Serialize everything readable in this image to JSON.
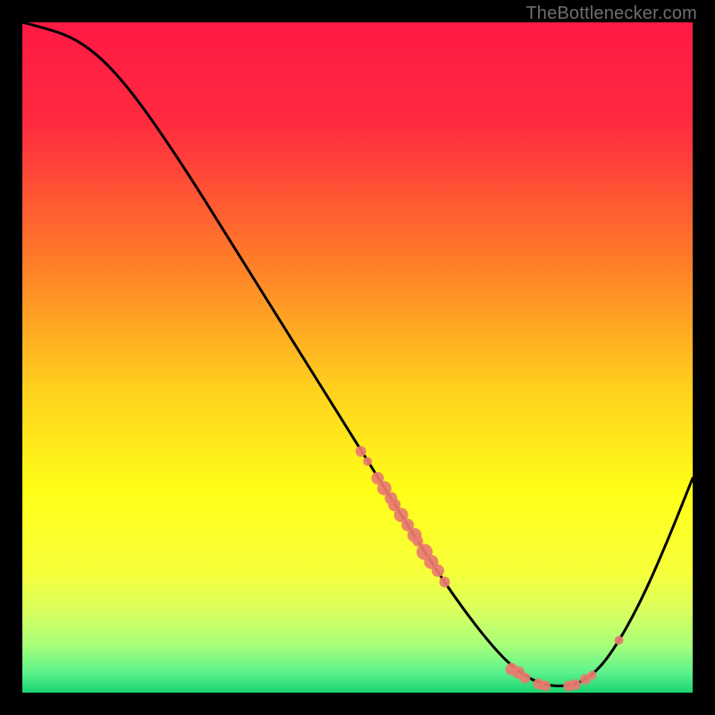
{
  "attribution": "TheBottlenecker.com",
  "chart_data": {
    "type": "line",
    "title": "",
    "xlabel": "",
    "ylabel": "",
    "xlim": [
      0,
      100
    ],
    "ylim": [
      0,
      100
    ],
    "gradient_stops": [
      {
        "offset": 0.0,
        "color": "#ff1a44"
      },
      {
        "offset": 0.15,
        "color": "#ff2a3f"
      },
      {
        "offset": 0.35,
        "color": "#ff7a2a"
      },
      {
        "offset": 0.55,
        "color": "#ffd21e"
      },
      {
        "offset": 0.7,
        "color": "#ffff18"
      },
      {
        "offset": 0.82,
        "color": "#f7ff3a"
      },
      {
        "offset": 0.88,
        "color": "#d8ff60"
      },
      {
        "offset": 0.93,
        "color": "#a6ff7a"
      },
      {
        "offset": 0.97,
        "color": "#5cf28c"
      },
      {
        "offset": 1.0,
        "color": "#18d470"
      }
    ],
    "curve": [
      {
        "x": 0,
        "y": 100
      },
      {
        "x": 4,
        "y": 99
      },
      {
        "x": 8,
        "y": 97.5
      },
      {
        "x": 12,
        "y": 94.5
      },
      {
        "x": 16,
        "y": 90
      },
      {
        "x": 20,
        "y": 84.5
      },
      {
        "x": 25,
        "y": 77
      },
      {
        "x": 30,
        "y": 69
      },
      {
        "x": 35,
        "y": 61
      },
      {
        "x": 40,
        "y": 53
      },
      {
        "x": 45,
        "y": 45
      },
      {
        "x": 50,
        "y": 37
      },
      {
        "x": 55,
        "y": 29
      },
      {
        "x": 60,
        "y": 21
      },
      {
        "x": 65,
        "y": 13.5
      },
      {
        "x": 70,
        "y": 7
      },
      {
        "x": 74,
        "y": 3
      },
      {
        "x": 78,
        "y": 1
      },
      {
        "x": 82,
        "y": 1
      },
      {
        "x": 85,
        "y": 2.5
      },
      {
        "x": 88,
        "y": 6
      },
      {
        "x": 92,
        "y": 13
      },
      {
        "x": 96,
        "y": 22
      },
      {
        "x": 100,
        "y": 32
      }
    ],
    "markers": [
      {
        "x": 50.5,
        "y": 36,
        "r": 6
      },
      {
        "x": 51.5,
        "y": 34.5,
        "r": 5
      },
      {
        "x": 53,
        "y": 32,
        "r": 7
      },
      {
        "x": 54,
        "y": 30.5,
        "r": 8
      },
      {
        "x": 55,
        "y": 29,
        "r": 7
      },
      {
        "x": 55.5,
        "y": 28,
        "r": 7
      },
      {
        "x": 56.5,
        "y": 26.5,
        "r": 8
      },
      {
        "x": 57.5,
        "y": 25,
        "r": 7
      },
      {
        "x": 58.5,
        "y": 23.5,
        "r": 8
      },
      {
        "x": 59,
        "y": 22.6,
        "r": 6
      },
      {
        "x": 60,
        "y": 21,
        "r": 9
      },
      {
        "x": 61,
        "y": 19.5,
        "r": 8
      },
      {
        "x": 62,
        "y": 18.2,
        "r": 7
      },
      {
        "x": 63,
        "y": 16.5,
        "r": 6
      },
      {
        "x": 73,
        "y": 3.5,
        "r": 7
      },
      {
        "x": 74,
        "y": 3.0,
        "r": 7
      },
      {
        "x": 75,
        "y": 2.2,
        "r": 6
      },
      {
        "x": 77,
        "y": 1.3,
        "r": 6
      },
      {
        "x": 78,
        "y": 1.0,
        "r": 6
      },
      {
        "x": 81.5,
        "y": 1.0,
        "r": 6
      },
      {
        "x": 82.5,
        "y": 1.2,
        "r": 6
      },
      {
        "x": 84,
        "y": 2.0,
        "r": 6
      },
      {
        "x": 85,
        "y": 2.6,
        "r": 5
      },
      {
        "x": 89,
        "y": 7.8,
        "r": 5
      }
    ],
    "marker_color": "#e97b6f"
  }
}
